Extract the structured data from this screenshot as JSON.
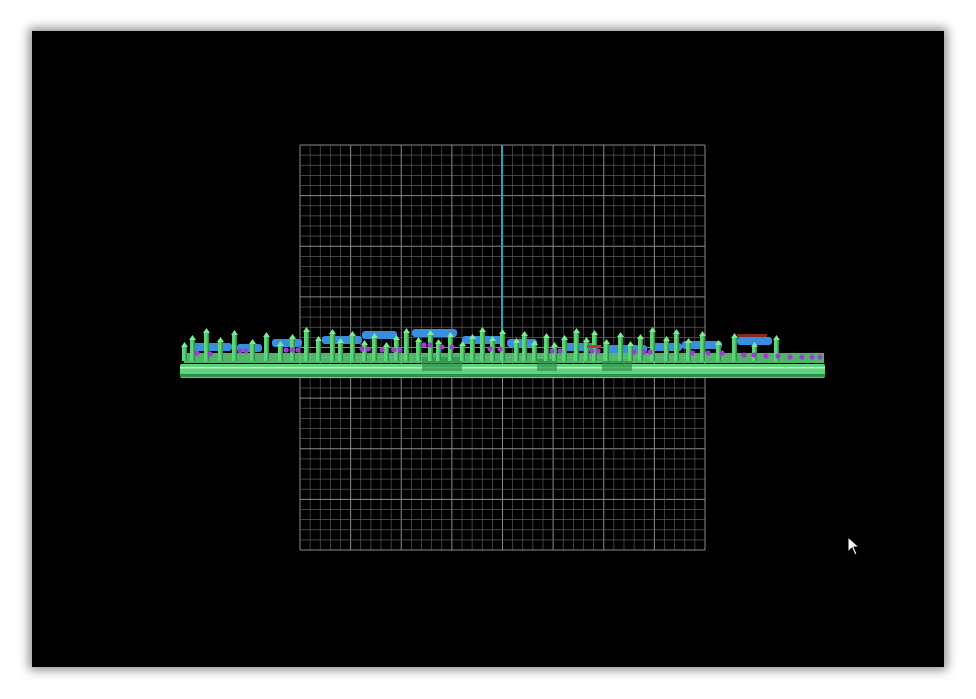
{
  "viewport": {
    "background_color": "#000000",
    "grid": {
      "visible": true,
      "divisions": 40,
      "line_color": "#5a5a5a",
      "major_line_color": "#8a8a8a",
      "major_every": 5,
      "axis_line_color": "#2aa3b8"
    },
    "model": {
      "name": "board-side-view",
      "body_color": "#5fd37a",
      "body_shadow_color": "#2f8f4c",
      "component_color": "#3a8ee0",
      "marker_color": "#9b3fd0",
      "accent_color": "#c0392b"
    },
    "cursor_icon": "arrow-pointer-icon"
  }
}
